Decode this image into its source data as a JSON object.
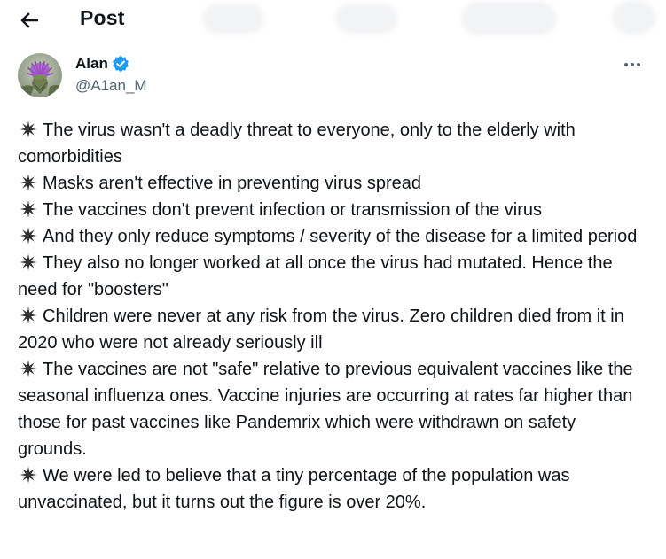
{
  "header": {
    "title": "Post",
    "back_icon": "arrow-left-icon"
  },
  "author": {
    "display_name": "Alan",
    "handle": "@A1an_M",
    "verified_icon": "verified-badge-icon",
    "verified_color": "#1d9bf0",
    "avatar_icon": "thistle-flower-avatar",
    "more_icon": "more-horizontal-icon"
  },
  "post": {
    "bullet_icon": "eight-pointed-star-icon",
    "items": [
      "The virus wasn't a deadly threat to everyone, only to the elderly with comorbidities",
      "Masks aren't effective in preventing virus spread",
      "The vaccines don't prevent infection or transmission of the virus",
      "And they only reduce symptoms / severity of the disease for a limited period",
      "They also no longer worked at all once the virus had mutated. Hence the need for \"boosters\"",
      "Children were never at any risk from the virus. Zero children died from it in 2020 who were not already seriously ill",
      "The vaccines are not \"safe\" relative to previous equivalent vaccines like the seasonal influenza ones. Vaccine injuries are occurring at rates far higher than those for past vaccines like Pandemrix which were withdrawn on safety grounds.",
      "We were led to believe that a tiny percentage of the population was unvaccinated, but it turns out the figure is over 20%."
    ]
  }
}
